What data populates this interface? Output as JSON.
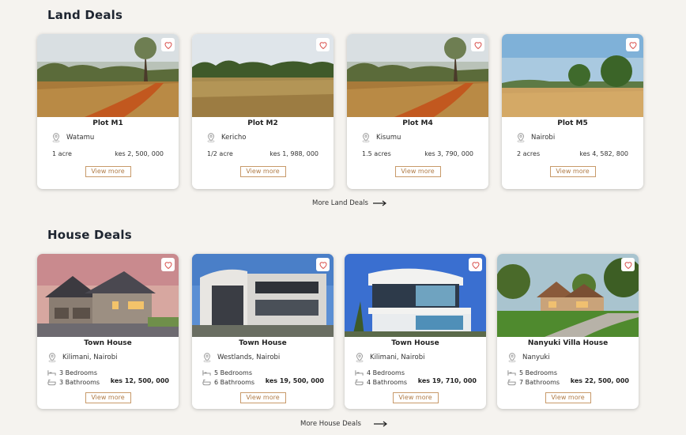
{
  "land": {
    "title": "Land Deals",
    "more_label": "More Land Deals",
    "cards": [
      {
        "title": "Plot M1",
        "location": "Watamu",
        "size": "1 acre",
        "price": "kes 2, 500, 000",
        "cta": "View more"
      },
      {
        "title": "Plot M2",
        "location": "Kericho",
        "size": "1/2 acre",
        "price": "kes 1, 988, 000",
        "cta": "View more"
      },
      {
        "title": "Plot M4",
        "location": "Kisumu",
        "size": "1.5 acres",
        "price": "kes 3, 790, 000",
        "cta": "View more"
      },
      {
        "title": "Plot M5",
        "location": "Nairobi",
        "size": "2 acres",
        "price": "kes 4, 582, 800",
        "cta": "View more"
      }
    ]
  },
  "house": {
    "title": "House Deals",
    "more_label": "More House Deals",
    "cards": [
      {
        "title": "Town House",
        "location": "Kilimani, Nairobi",
        "bedrooms": "3 Bedrooms",
        "bathrooms": "3 Bathrooms",
        "price": "kes 12, 500, 000",
        "cta": "View more"
      },
      {
        "title": "Town House",
        "location": "Westlands, Nairobi",
        "bedrooms": "5 Bedrooms",
        "bathrooms": "6 Bathrooms",
        "price": "kes 19, 500, 000",
        "cta": "View more"
      },
      {
        "title": "Town House",
        "location": "Kilimani, Nairobi",
        "bedrooms": "4 Bedrooms",
        "bathrooms": "4 Bathrooms",
        "price": "kes 19, 710, 000",
        "cta": "View more"
      },
      {
        "title": "Nanyuki Villa House",
        "location": "Nanyuki",
        "bedrooms": "5 Bedrooms",
        "bathrooms": "7 Bathrooms",
        "price": "kes 22, 500, 000",
        "cta": "View more"
      }
    ]
  },
  "icons": {
    "favorite": "heart-outline-icon",
    "location": "map-pin-icon",
    "bed": "bed-icon",
    "bath": "bathtub-icon",
    "arrow": "arrow-right-icon"
  },
  "colors": {
    "accent": "#c89a6a",
    "accent_text": "#b07c48",
    "heart": "#d9534f",
    "background": "#f5f3ef"
  }
}
